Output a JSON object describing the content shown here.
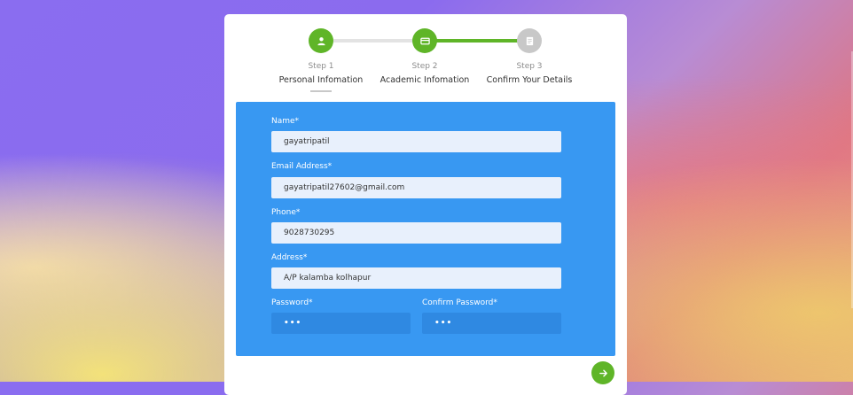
{
  "steps": [
    {
      "number": "Step 1",
      "title": "Personal Infomation",
      "state": "complete",
      "icon": "user-icon"
    },
    {
      "number": "Step 2",
      "title": "Academic Infomation",
      "state": "complete",
      "icon": "card-icon"
    },
    {
      "number": "Step 3",
      "title": "Confirm Your Details",
      "state": "pending",
      "icon": "document-icon"
    }
  ],
  "form": {
    "name": {
      "label": "Name*",
      "value": "gayatripatil"
    },
    "email": {
      "label": "Email Address*",
      "value": "gayatripatil27602@gmail.com"
    },
    "phone": {
      "label": "Phone*",
      "value": "9028730295"
    },
    "address": {
      "label": "Address*",
      "value": "A/P kalamba kolhapur"
    },
    "password": {
      "label": "Password*",
      "value": "•••"
    },
    "confirm_password": {
      "label": "Confirm Password*",
      "value": "•••"
    }
  },
  "next_button": {
    "icon": "arrow-right-icon"
  },
  "colors": {
    "accent_green": "#5fb528",
    "panel_blue": "#3898f2",
    "pending_gray": "#c8c8c8"
  }
}
